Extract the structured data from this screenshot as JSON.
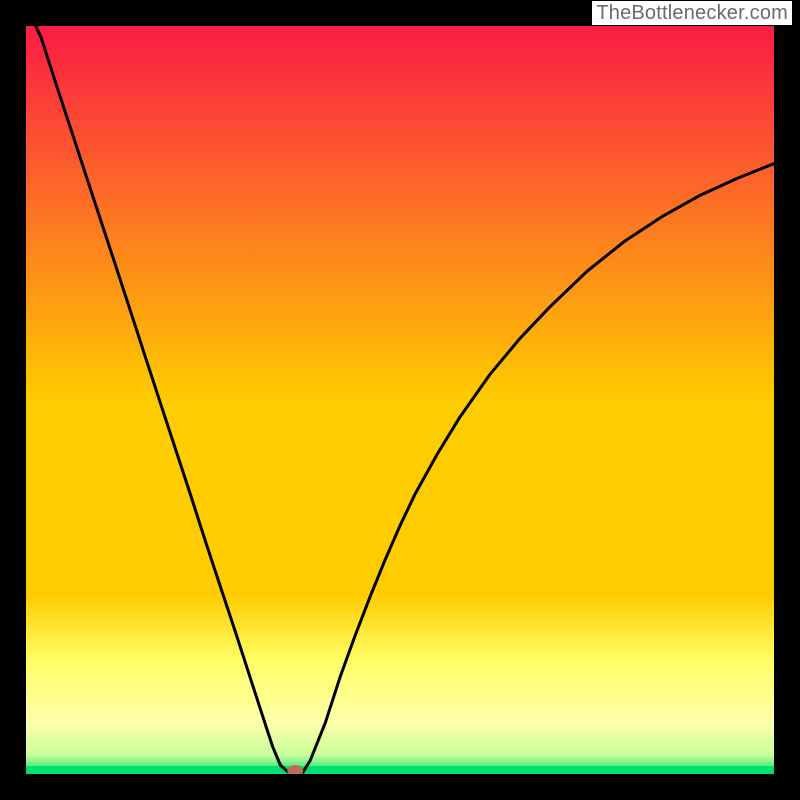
{
  "attribution": "TheBottlenecker.com",
  "colors": {
    "frame": "#000000",
    "gradient_top": "#fb1b46",
    "gradient_mid": "#ffcc00",
    "gradient_low1": "#ffff66",
    "gradient_low2": "#ffffaa",
    "gradient_bottom": "#00e070",
    "curve": "#000000",
    "marker": "#bc6b5e"
  },
  "chart_data": {
    "type": "line",
    "title": "",
    "xlabel": "",
    "ylabel": "",
    "xlim": [
      0,
      1
    ],
    "ylim": [
      0,
      1
    ],
    "x": [
      0.0,
      0.02,
      0.04,
      0.06,
      0.08,
      0.1,
      0.12,
      0.14,
      0.16,
      0.18,
      0.2,
      0.22,
      0.24,
      0.26,
      0.28,
      0.3,
      0.32,
      0.33,
      0.34,
      0.35,
      0.36,
      0.37,
      0.38,
      0.4,
      0.42,
      0.44,
      0.46,
      0.48,
      0.5,
      0.52,
      0.55,
      0.58,
      0.62,
      0.66,
      0.7,
      0.75,
      0.8,
      0.85,
      0.9,
      0.95,
      1.0
    ],
    "y": [
      1.045,
      0.985,
      0.923,
      0.862,
      0.801,
      0.74,
      0.679,
      0.618,
      0.556,
      0.495,
      0.434,
      0.373,
      0.311,
      0.25,
      0.19,
      0.128,
      0.066,
      0.036,
      0.012,
      0.003,
      0.002,
      0.002,
      0.018,
      0.068,
      0.13,
      0.185,
      0.237,
      0.286,
      0.332,
      0.374,
      0.428,
      0.477,
      0.534,
      0.582,
      0.624,
      0.672,
      0.712,
      0.745,
      0.773,
      0.796,
      0.816
    ],
    "marker": {
      "x": 0.36,
      "y": 0.004
    }
  }
}
